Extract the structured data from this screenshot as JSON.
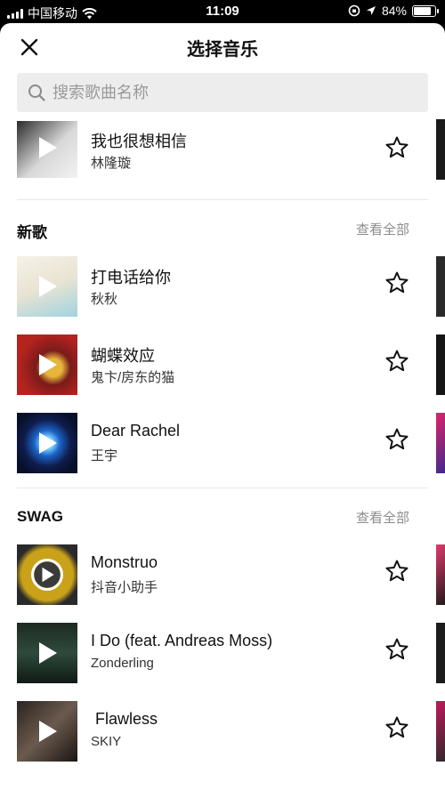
{
  "status_bar": {
    "carrier": "中国移动",
    "time": "11:09",
    "battery": "84%"
  },
  "header": {
    "title": "选择音乐"
  },
  "search": {
    "placeholder": "搜索歌曲名称"
  },
  "top_song": {
    "name": "我也很想相信",
    "artist": "林隆璇"
  },
  "sections": [
    {
      "label": "新歌",
      "more": "查看全部",
      "songs": [
        {
          "name": "打电话给你",
          "artist": "秋秋"
        },
        {
          "name": "蝴蝶效应",
          "artist": "鬼卞/房东的猫"
        },
        {
          "name": "Dear Rachel",
          "artist": "王宇"
        }
      ]
    },
    {
      "label": "SWAG",
      "more": "查看全部",
      "songs": [
        {
          "name": "Monstruo",
          "artist": "抖音小助手"
        },
        {
          "name": "I Do (feat. Andreas Moss)",
          "artist": "Zonderling"
        },
        {
          "name": " Flawless",
          "artist": "SKIY"
        }
      ]
    }
  ],
  "colors": {
    "background": "#ffffff",
    "status_bar": "#000000",
    "muted": "#8c8c8c",
    "search_bg": "#ededed"
  }
}
